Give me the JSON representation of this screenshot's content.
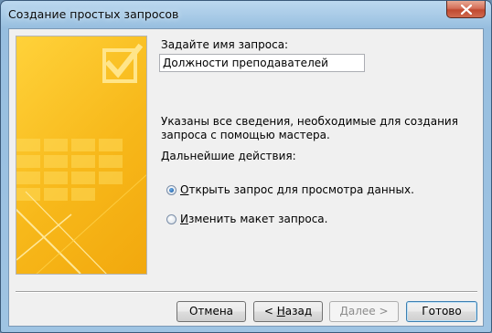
{
  "window": {
    "title": "Создание простых запросов"
  },
  "form": {
    "name_label": "Задайте имя запроса:",
    "name_value": "Должности преподавателей",
    "info_text": "Указаны все сведения, необходимые для создания запроса с помощью мастера.",
    "next_label": "Дальнейшие действия:",
    "options": [
      {
        "prefix": "",
        "accel": "О",
        "rest": "ткрыть запрос для просмотра данных.",
        "checked": true
      },
      {
        "prefix": "",
        "accel": "И",
        "rest": "зменить макет запроса.",
        "checked": false
      }
    ]
  },
  "buttons": {
    "cancel": "Отмена",
    "back_prefix": "< ",
    "back_accel": "Н",
    "back_rest": "азад",
    "next": "Далее >",
    "finish": "Готово"
  },
  "colors": {
    "art_yellow": "#f7b81a",
    "default_button_border": "#3c7fb1"
  }
}
